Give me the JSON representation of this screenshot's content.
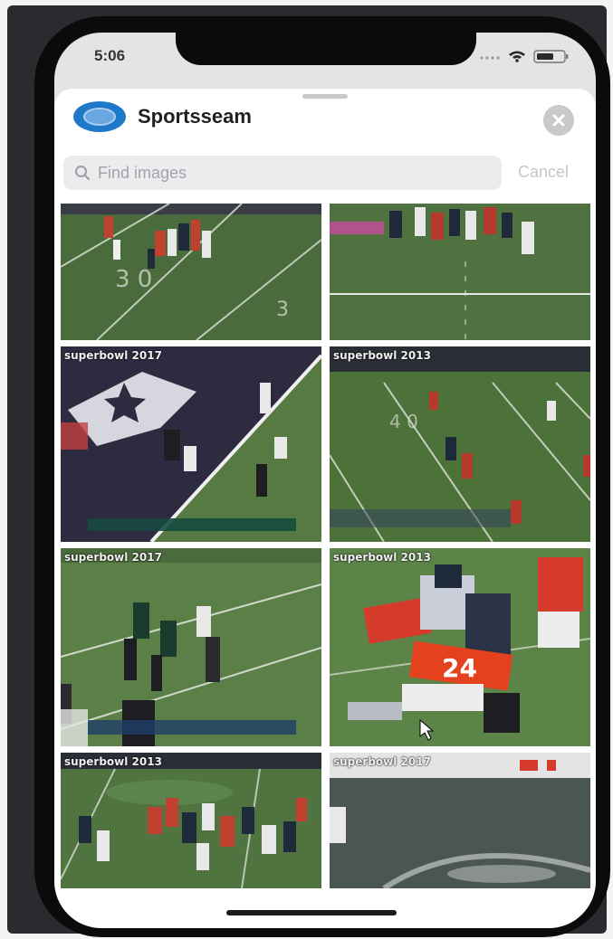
{
  "status_bar": {
    "time": "5:06",
    "icons": [
      "signal-icon",
      "wifi-icon",
      "battery-icon"
    ]
  },
  "header": {
    "app_name": "Sportsseam",
    "logo_icon": "sportsseam-logo-icon",
    "close_icon": "close-icon"
  },
  "search": {
    "placeholder": "Find images",
    "value": "",
    "cancel_label": "Cancel"
  },
  "gallery": {
    "thumbnails": [
      {
        "caption": ""
      },
      {
        "caption": ""
      },
      {
        "caption": "superbowl 2017"
      },
      {
        "caption": "superbowl 2013"
      },
      {
        "caption": "superbowl 2017"
      },
      {
        "caption": "superbowl 2013"
      },
      {
        "caption": "superbowl 2013"
      },
      {
        "caption": "superbowl 2017"
      }
    ]
  },
  "colors": {
    "accent": "#1f79c9",
    "field_green": "#49683a",
    "endzone_navy": "#2d2b40"
  }
}
